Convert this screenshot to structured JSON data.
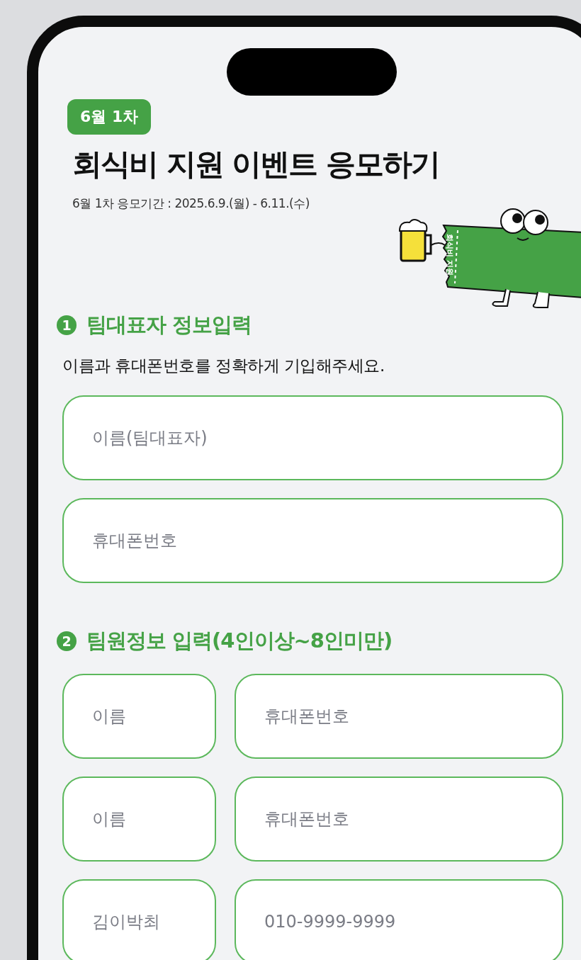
{
  "badge": "6월 1차",
  "title": "회식비 지원 이벤트 응모하기",
  "period": "6월 1차 응모기간 : 2025.6.9.(월) - 6.11.(수)",
  "mascot": {
    "ticket_label": "회식비 지원"
  },
  "sections": [
    {
      "number": "1",
      "heading": "팀대표자 정보입력",
      "description": "이름과 휴대폰번호를 정확하게 기입해주세요.",
      "rows": [
        [
          {
            "placeholder": "이름(팀대표자)"
          }
        ],
        [
          {
            "placeholder": "휴대폰번호"
          }
        ]
      ]
    },
    {
      "number": "2",
      "heading": "팀원정보 입력(4인이상~8인미만)",
      "rows": [
        [
          {
            "placeholder": "이름"
          },
          {
            "placeholder": "휴대폰번호"
          }
        ],
        [
          {
            "placeholder": "이름"
          },
          {
            "placeholder": "휴대폰번호"
          }
        ],
        [
          {
            "placeholder": "김이박최"
          },
          {
            "placeholder": "010-9999-9999"
          }
        ]
      ]
    }
  ]
}
